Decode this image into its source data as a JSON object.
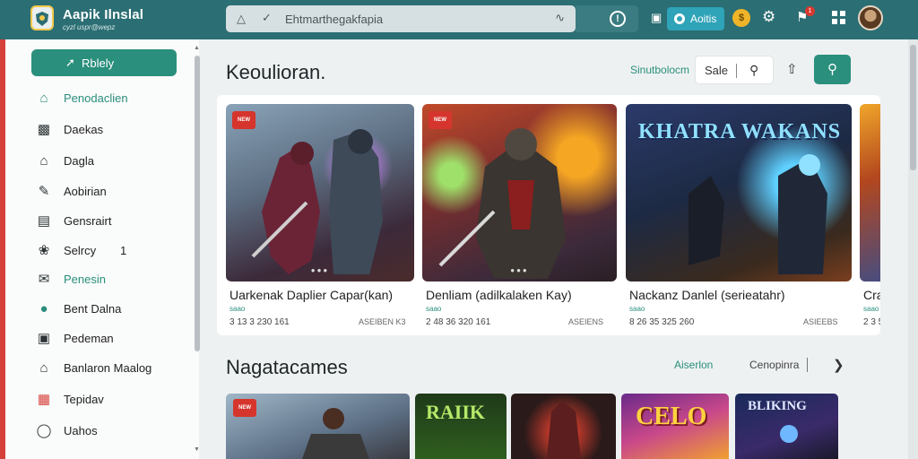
{
  "header": {
    "title": "Aapik Ilnslal",
    "subtitle": "cyzl uspr@wepz",
    "search_text": "Ehtmarthegakfapia",
    "account_label": "Aoitis",
    "notification_count": "1"
  },
  "sidebar": {
    "cta_label": "Rblely",
    "items": [
      {
        "label": "Penodaclien",
        "icon": "home-icon"
      },
      {
        "label": "Daekas",
        "icon": "bag-icon"
      },
      {
        "label": "Dagla",
        "icon": "house-icon"
      },
      {
        "label": "Aobirian",
        "icon": "pencil-icon"
      },
      {
        "label": "Gensrairt",
        "icon": "monitor-icon"
      },
      {
        "label": "Selrcy",
        "icon": "leaf-icon",
        "count": "1"
      },
      {
        "label": "Penesin",
        "icon": "mail-icon"
      },
      {
        "label": "Bent Dalna",
        "icon": "globe-icon"
      },
      {
        "label": "Pedeman",
        "icon": "camera-icon"
      },
      {
        "label": "Banlaron Maalog",
        "icon": "home-icon"
      },
      {
        "label": "Tepidav",
        "icon": "app-icon"
      },
      {
        "label": "Uahos",
        "icon": "circle-icon"
      }
    ]
  },
  "featured": {
    "title": "Keoulioran.",
    "see_all": "Sinutbolocm",
    "sort_label": "Sale",
    "cards": [
      {
        "name": "Uarkenak Daplier Capar(kan)",
        "genre": "saao",
        "stats": "3 13 3 230 161",
        "publisher": "ASEIBEN K3",
        "tag": "NEW"
      },
      {
        "name": "Denliam (adilkalaken Kay)",
        "genre": "saao",
        "stats": "2 48 36 320 161",
        "publisher": "ASEIENS",
        "tag": "NEW"
      },
      {
        "name": "Nackanz Danlel (serieatahr)",
        "genre": "saao",
        "stats": "8 26 35 325 260",
        "publisher": "ASIEEBS",
        "tag": "",
        "art_title": "KHATRA WAKANS"
      },
      {
        "name": "Cra",
        "genre": "saao",
        "stats": "2 3 5",
        "publisher": "",
        "tag": ""
      }
    ]
  },
  "new_games": {
    "title": "Nagatacames",
    "see_all": "Aiserlon",
    "filter": "Cenopinra",
    "tiles": [
      {
        "art_title": "",
        "tag": "NEW"
      },
      {
        "art_title": "RAIIK"
      },
      {
        "art_title": ""
      },
      {
        "art_title": "CELO"
      },
      {
        "art_title": "BLIKING"
      }
    ]
  }
}
